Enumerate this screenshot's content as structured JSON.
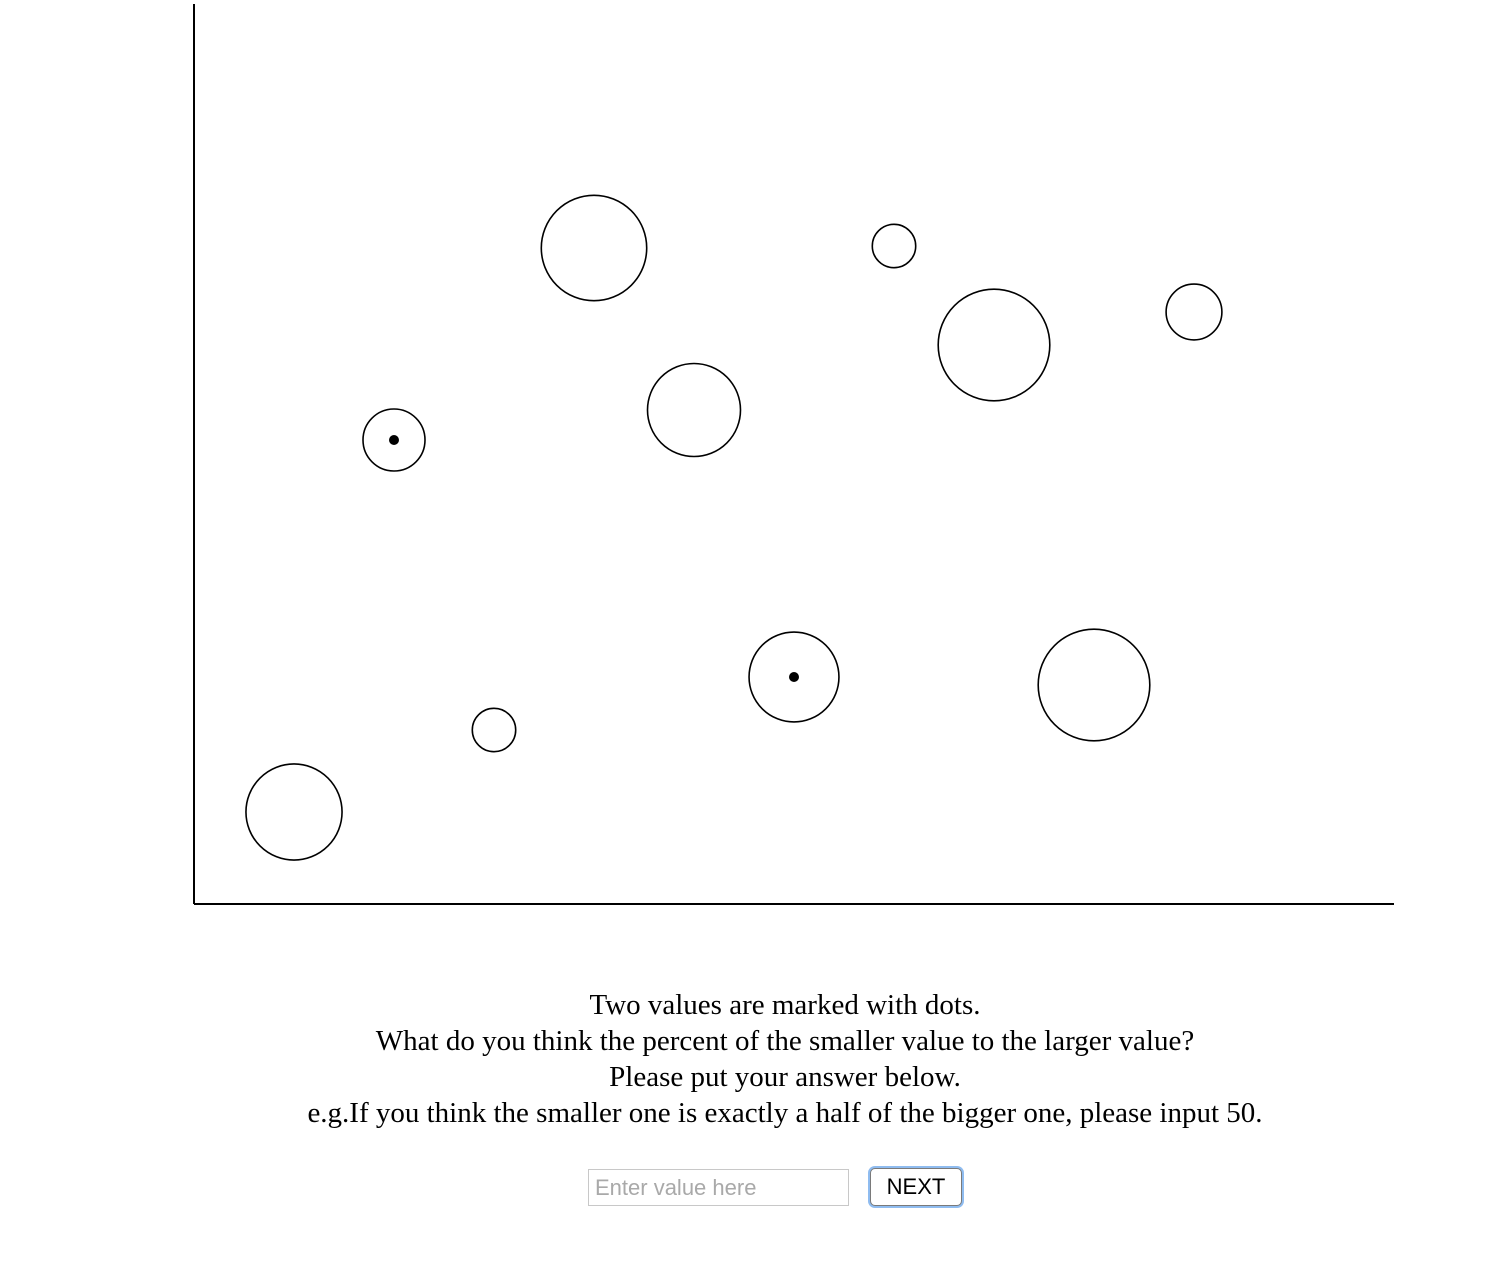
{
  "chart_data": {
    "type": "scatter",
    "title": "",
    "xlabel": "",
    "ylabel": "",
    "xlim": [
      0,
      12
    ],
    "ylim": [
      0,
      9
    ],
    "grid": false,
    "points": [
      {
        "x": 1,
        "y": 0.92,
        "size": 3.1,
        "marked": false
      },
      {
        "x": 2,
        "y": 4.64,
        "size": 2.0,
        "marked": true
      },
      {
        "x": 3,
        "y": 1.74,
        "size": 1.4,
        "marked": false
      },
      {
        "x": 4,
        "y": 6.56,
        "size": 3.4,
        "marked": false
      },
      {
        "x": 5,
        "y": 4.94,
        "size": 3.0,
        "marked": false
      },
      {
        "x": 6,
        "y": 2.27,
        "size": 2.9,
        "marked": true
      },
      {
        "x": 7,
        "y": 6.58,
        "size": 1.4,
        "marked": false
      },
      {
        "x": 8,
        "y": 5.59,
        "size": 3.6,
        "marked": false
      },
      {
        "x": 9,
        "y": 2.19,
        "size": 3.6,
        "marked": false
      },
      {
        "x": 10,
        "y": 5.92,
        "size": 1.8,
        "marked": false
      }
    ]
  },
  "instructions": {
    "line1": "Two values are marked with dots.",
    "line2": "What do you think the percent of the smaller value to the larger value?",
    "line3": "Please put your answer below.",
    "line4": "e.g.If you think the smaller one is exactly a half of the bigger one, please input 50."
  },
  "answer": {
    "placeholder": "Enter value here",
    "value": ""
  },
  "next_button": {
    "label": "NEXT"
  }
}
